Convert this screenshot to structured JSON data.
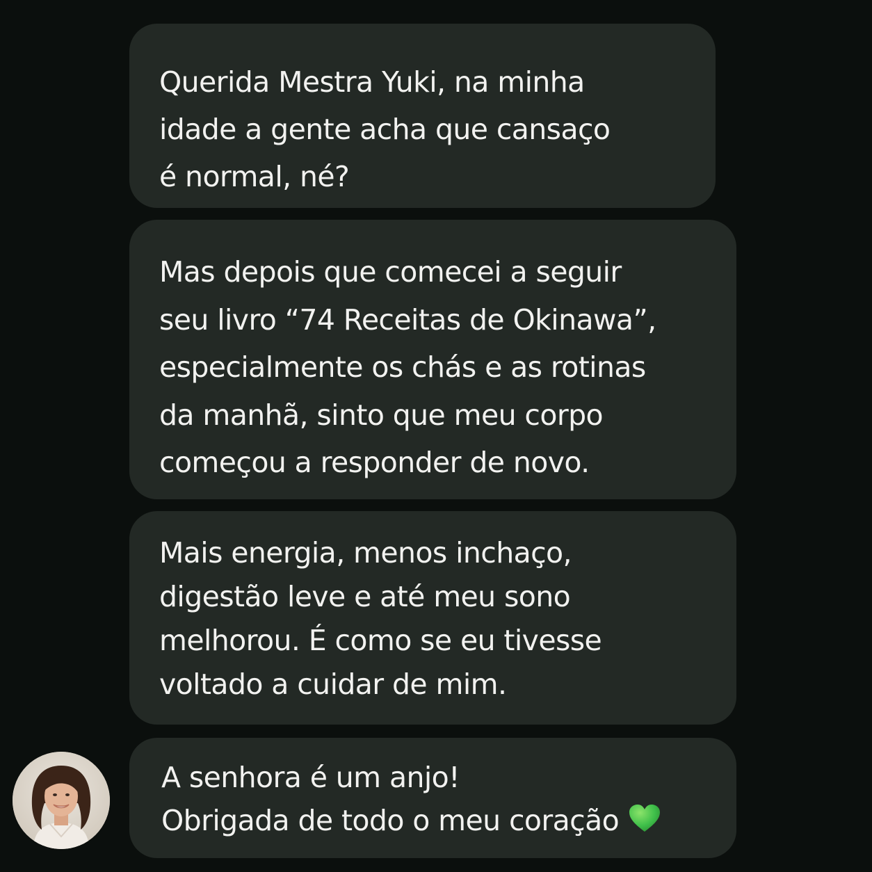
{
  "messages": [
    {
      "lines": [
        "Querida Mestra Yuki, na minha",
        "idade a gente acha que cansaço",
        "é normal, né?"
      ]
    },
    {
      "lines": [
        "Mas depois que comecei a seguir",
        "seu livro “74 Receitas de Okinawa”,",
        "especialmente os chás e as rotinas",
        "da manhã, sinto que meu corpo",
        "começou a responder de novo."
      ]
    },
    {
      "lines": [
        "Mais energia, menos inchaço,",
        "digestão leve e até meu sono",
        "melhorou. É como se eu tivesse",
        "voltado a cuidar de mim."
      ]
    },
    {
      "lines": [
        "A senhora é um anjo!",
        "Obrigada de todo o meu coração"
      ],
      "emoji": "green-heart-icon"
    }
  ],
  "colors": {
    "background": "#0b0f0d",
    "bubble": "#232925",
    "text": "#f2f2f0",
    "heart": "#3fbf4a"
  },
  "avatar": "sender-avatar"
}
